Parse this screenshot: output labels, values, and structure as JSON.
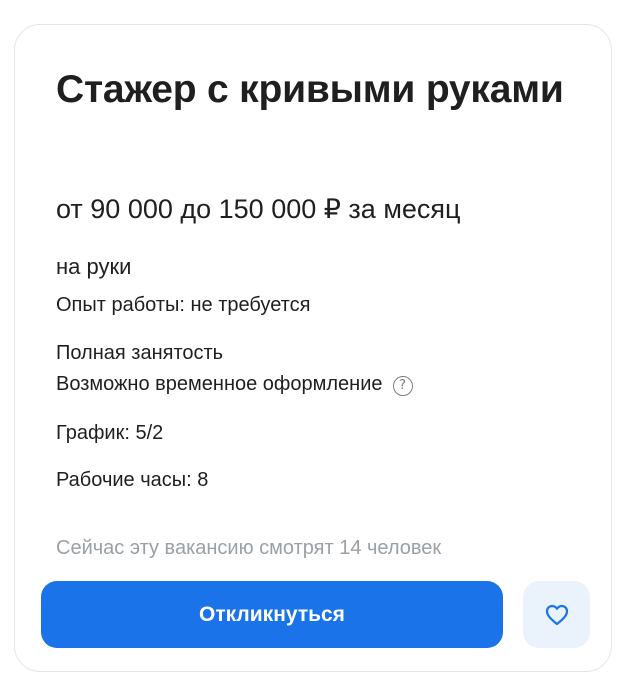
{
  "vacancy": {
    "title": "Стажер с кривыми руками",
    "salary": "от 90 000 до 150 000 ₽ за месяц",
    "salary_note": "на руки",
    "experience": "Опыт работы: не требуется",
    "employment": "Полная занятость",
    "temp_registration": "Возможно временное оформление",
    "schedule": "График: 5/2",
    "working_hours": "Рабочие часы: 8",
    "viewers": "Сейчас эту вакансию смотрят 14 человек"
  },
  "actions": {
    "respond_label": "Откликнуться"
  },
  "icons": {
    "help": "help-circle-icon",
    "favorite": "heart-outline-icon"
  },
  "colors": {
    "primary": "#1a73e8",
    "favorite_bg": "#eaf3fc",
    "muted_text": "#9aa0a6"
  }
}
